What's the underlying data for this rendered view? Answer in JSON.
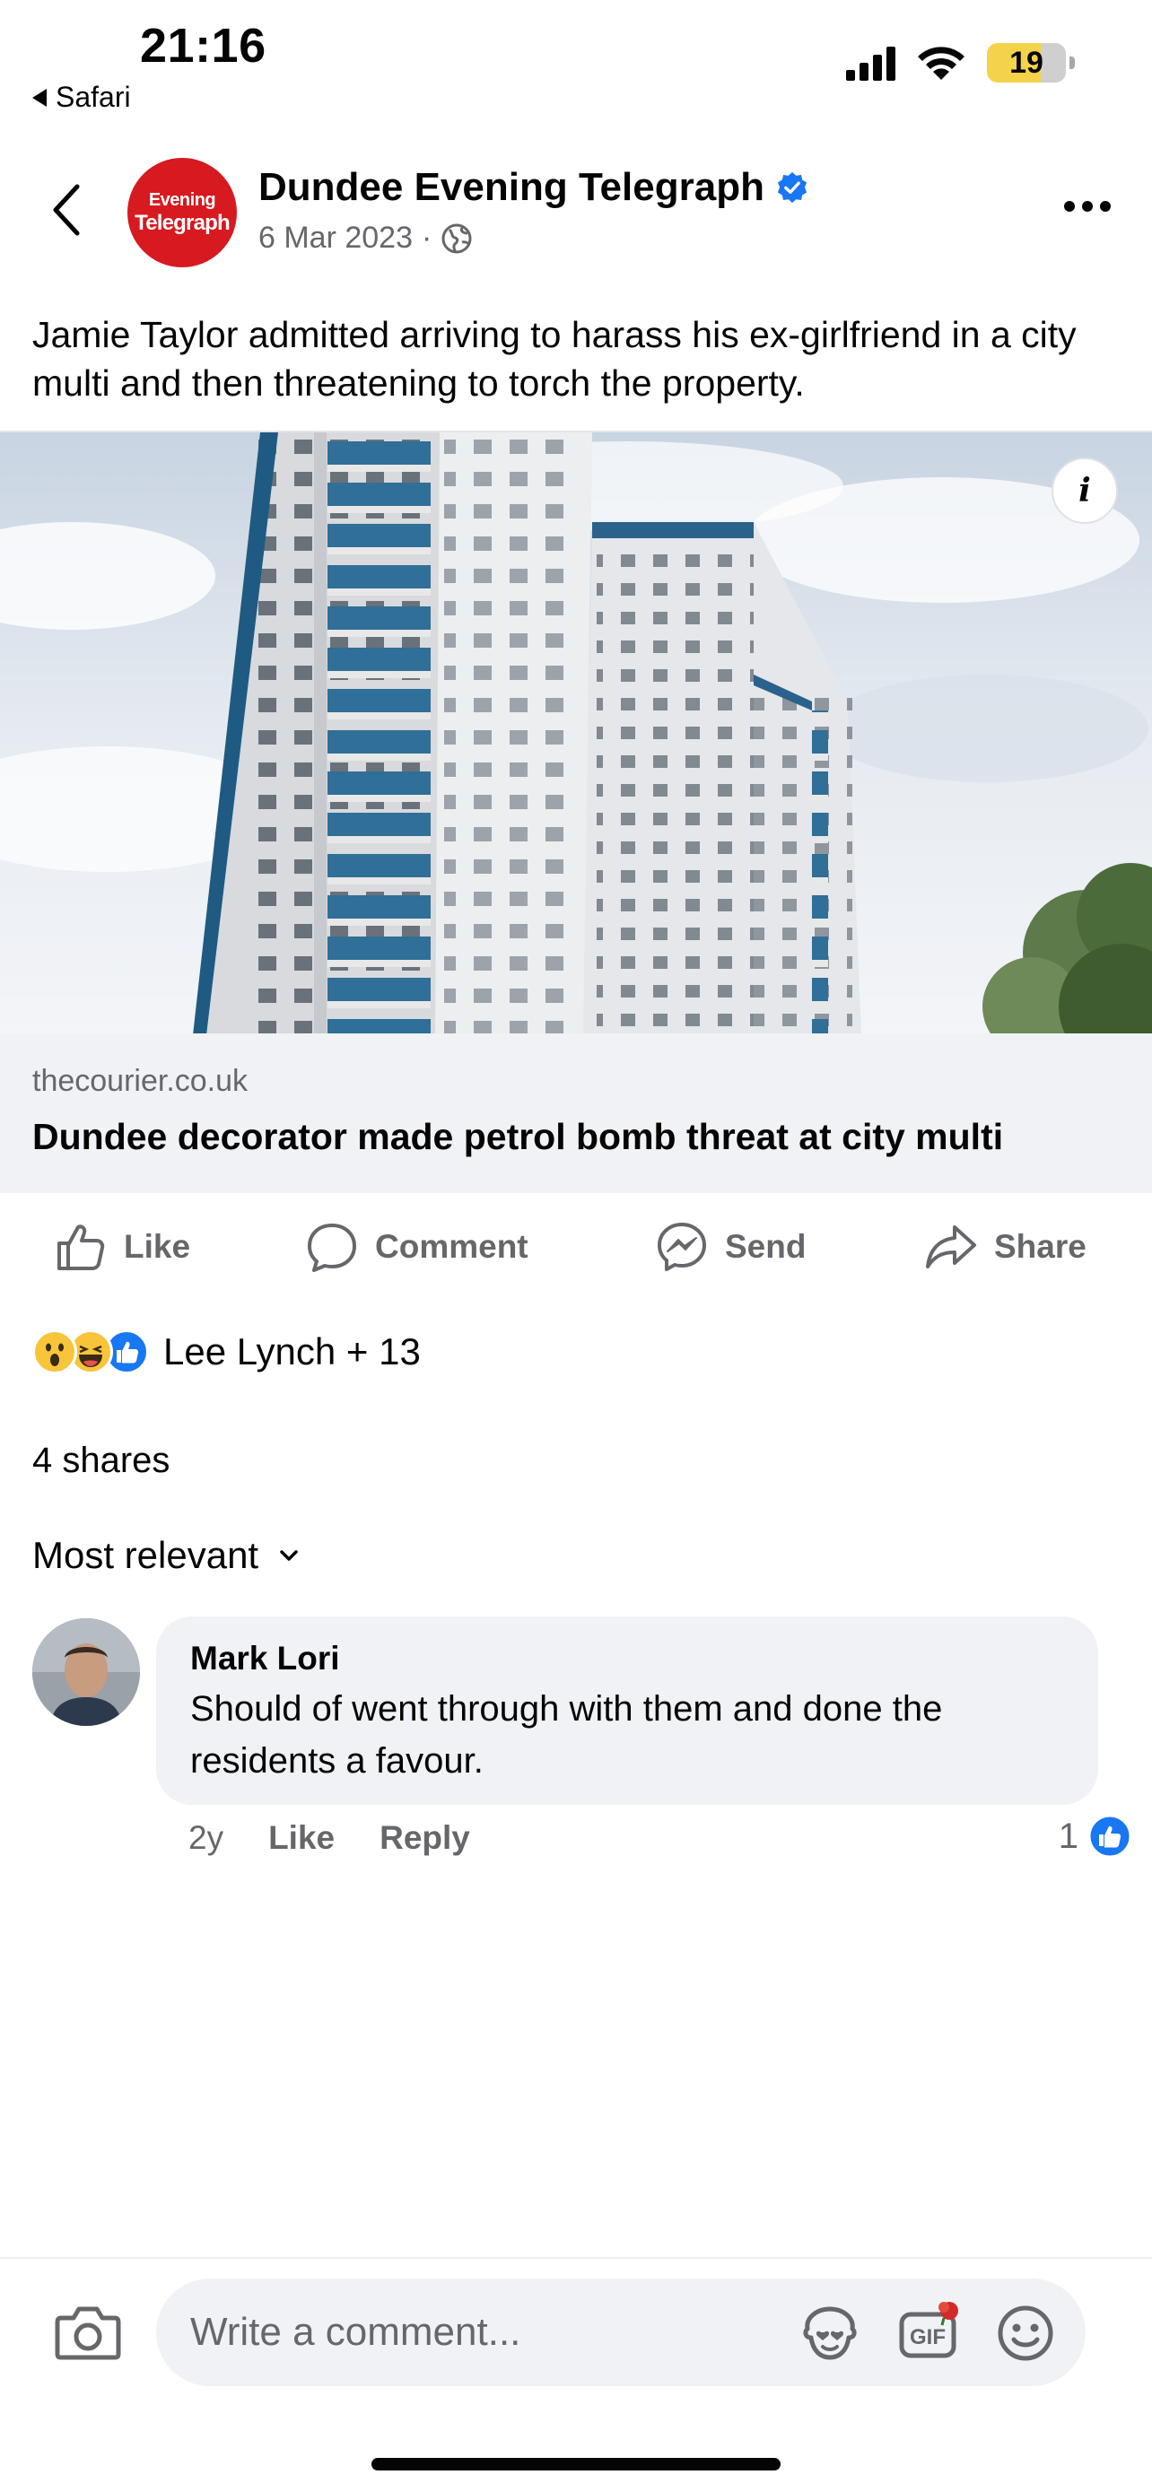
{
  "status_bar": {
    "time": "21:16",
    "back_app": "Safari",
    "battery": "19"
  },
  "header": {
    "page_name": "Dundee Evening Telegraph",
    "avatar_line1": "Evening",
    "avatar_line2": "Telegraph",
    "date": "6 Mar 2023",
    "separator": "·",
    "verified_icon": "verified-badge-icon",
    "audience_icon": "globe-icon"
  },
  "post": {
    "text": "Jamie Taylor admitted arriving to harass his ex-girlfriend in a city multi and then threatening to torch the property."
  },
  "link_card": {
    "domain": "thecourier.co.uk",
    "title": "Dundee decorator made petrol bomb threat at city multi",
    "info_glyph": "i"
  },
  "actions": {
    "like": "Like",
    "comment": "Comment",
    "send": "Send",
    "share": "Share"
  },
  "reactions": {
    "summary": "Lee Lynch + 13",
    "types": [
      "wow",
      "haha",
      "like"
    ]
  },
  "shares_text": "4 shares",
  "sort_label": "Most relevant",
  "comment": {
    "author": "Mark Lori",
    "body": "Should of went through with them and done the residents a favour.",
    "age": "2y",
    "like_label": "Like",
    "reply_label": "Reply",
    "like_count": "1"
  },
  "composer": {
    "placeholder": "Write a comment..."
  },
  "colors": {
    "facebook_blue": "#1877F2",
    "brand_red": "#D71920",
    "secondary_text": "#65676B",
    "bubble_gray": "#F0F2F5"
  }
}
